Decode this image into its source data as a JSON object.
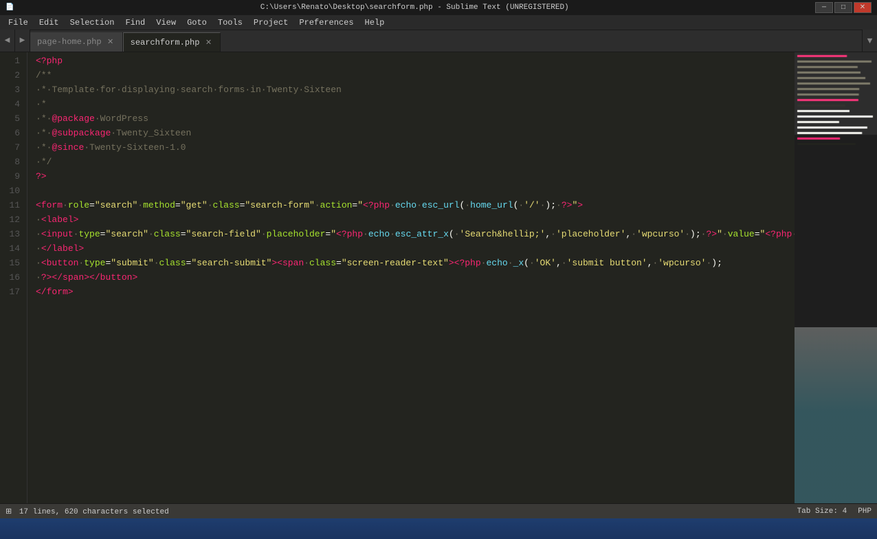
{
  "titleBar": {
    "title": "C:\\Users\\Renato\\Desktop\\searchform.php - Sublime Text (UNREGISTERED)",
    "minimize": "─",
    "maximize": "□",
    "close": "✕"
  },
  "menu": {
    "items": [
      "File",
      "Edit",
      "Selection",
      "Find",
      "View",
      "Goto",
      "Tools",
      "Project",
      "Preferences",
      "Help"
    ]
  },
  "tabs": [
    {
      "label": "page-home.php",
      "active": false
    },
    {
      "label": "searchform.php",
      "active": true
    }
  ],
  "statusBar": {
    "left": "   17 lines, 620 characters selected",
    "middle": "",
    "tabSize": "Tab Size: 4",
    "language": "PHP"
  },
  "lineCount": 17
}
